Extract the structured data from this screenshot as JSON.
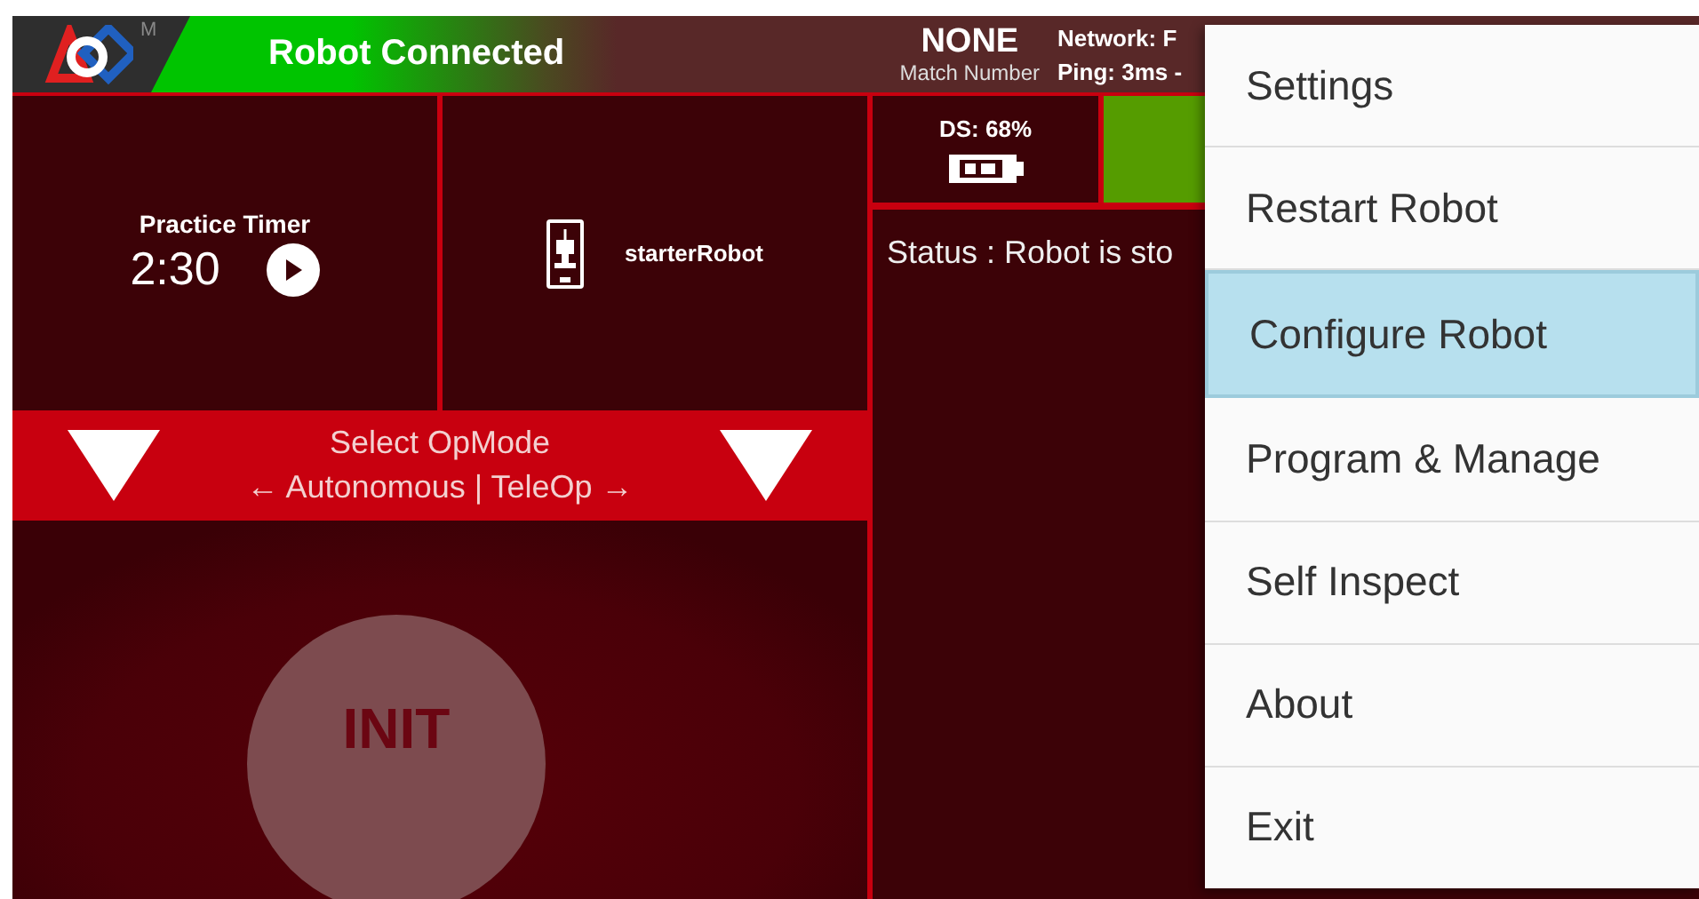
{
  "header": {
    "logo_mark": "M",
    "connection_status": "Robot Connected",
    "match": {
      "value": "NONE",
      "label": "Match Number"
    },
    "network": "Network: F",
    "ping": "Ping: 3ms -"
  },
  "timer": {
    "label": "Practice Timer",
    "time": "2:30"
  },
  "robot_config": {
    "name": "starterRobot"
  },
  "opmode": {
    "title": "Select OpMode",
    "subtitle": "← Autonomous | TeleOp →"
  },
  "init_button": {
    "label": "INIT"
  },
  "driver_station": {
    "battery": "DS: 68%"
  },
  "status": {
    "text": "Status : Robot is sto"
  },
  "menu": {
    "items": [
      {
        "label": "Settings",
        "selected": false
      },
      {
        "label": "Restart Robot",
        "selected": false
      },
      {
        "label": "Configure Robot",
        "selected": true
      },
      {
        "label": "Program & Manage",
        "selected": false
      },
      {
        "label": "Self Inspect",
        "selected": false
      },
      {
        "label": "About",
        "selected": false
      },
      {
        "label": "Exit",
        "selected": false
      }
    ]
  }
}
